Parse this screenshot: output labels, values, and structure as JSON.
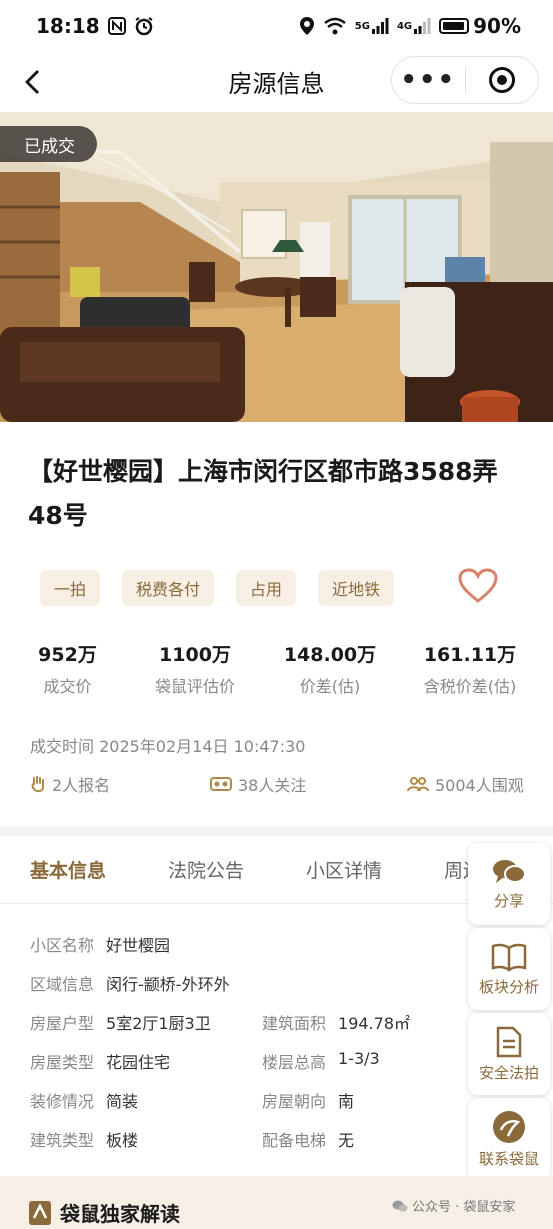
{
  "status_bar": {
    "time": "18:18",
    "network_1": "5G",
    "network_2": "4G",
    "battery": "90%"
  },
  "nav": {
    "title": "房源信息",
    "more": "•••"
  },
  "photo": {
    "status_badge": "已成交"
  },
  "listing": {
    "title": "【好世樱园】上海市闵行区都市路3588弄48号",
    "tags": [
      "一拍",
      "税费各付",
      "占用",
      "近地铁"
    ],
    "stats": [
      {
        "value": "952万",
        "label": "成交价"
      },
      {
        "value": "1100万",
        "label": "袋鼠评估价"
      },
      {
        "value": "148.00万",
        "label": "价差(估)"
      },
      {
        "value": "161.11万",
        "label": "含税价差(估)"
      }
    ],
    "deal_time": "成交时间 2025年02月14日 10:47:30",
    "engagement": {
      "signups": "2人报名",
      "followers": "38人关注",
      "viewers": "5004人围观"
    }
  },
  "tabs": [
    "基本信息",
    "法院公告",
    "小区详情",
    "周边"
  ],
  "basic_info": {
    "community_label": "小区名称",
    "community": "好世樱园",
    "area_label": "区域信息",
    "area": "闵行-颛桥-外环外",
    "layout_label": "房屋户型",
    "layout": "5室2厅1厨3卫",
    "building_area_label": "建筑面积",
    "building_area": "194.78㎡",
    "house_type_label": "房屋类型",
    "house_type": "花园住宅",
    "floor_label": "楼层总高",
    "floor": "1-3/3",
    "decoration_label": "装修情况",
    "decoration": "简装",
    "orientation_label": "房屋朝向",
    "orientation": "南",
    "building_type_label": "建筑类型",
    "building_type": "板楼",
    "elevator_label": "配备电梯",
    "elevator": "无"
  },
  "float_buttons": [
    "分享",
    "板块分析",
    "安全法拍",
    "联系袋鼠"
  ],
  "bottom": {
    "section_title": "袋鼠独家解读",
    "watermark": "公众号 · 袋鼠安家"
  },
  "colors": {
    "accent": "#8a6a3a",
    "tag_bg": "#f7efe3",
    "heart": "#d9826a"
  }
}
